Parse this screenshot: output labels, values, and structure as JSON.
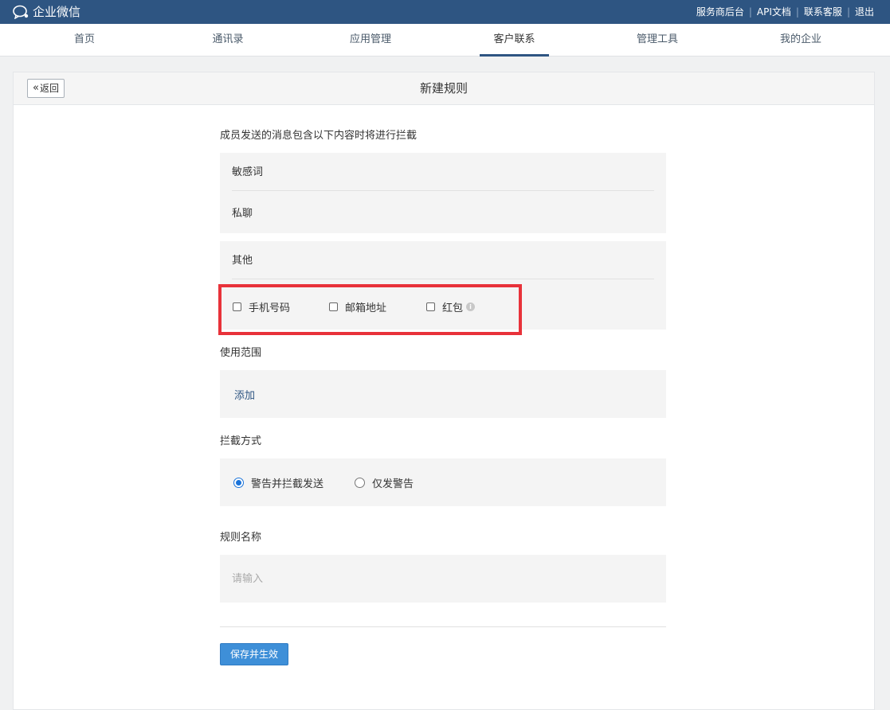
{
  "brand": {
    "name": "企业微信"
  },
  "top_links": [
    "服务商后台",
    "API文档",
    "联系客服",
    "退出"
  ],
  "nav": [
    "首页",
    "通讯录",
    "应用管理",
    "客户联系",
    "管理工具",
    "我的企业"
  ],
  "nav_active": "客户联系",
  "header": {
    "back_label": "返回",
    "title": "新建规则"
  },
  "intercept": {
    "label": "成员发送的消息包含以下内容时将进行拦截",
    "rows": [
      "敏感词",
      "私聊"
    ],
    "other_label": "其他",
    "options": [
      {
        "label": "手机号码",
        "checked": false
      },
      {
        "label": "邮箱地址",
        "checked": false
      },
      {
        "label": "红包",
        "checked": false
      }
    ]
  },
  "scope": {
    "label": "使用范围",
    "add_label": "添加"
  },
  "method": {
    "label": "拦截方式",
    "options": [
      {
        "label": "警告并拦截发送",
        "selected": true
      },
      {
        "label": "仅发警告",
        "selected": false
      }
    ]
  },
  "rule_name": {
    "label": "规则名称",
    "placeholder": "请输入",
    "value": ""
  },
  "save_label": "保存并生效",
  "colors": {
    "topbar": "#2e5582",
    "accent": "#3e8fd8",
    "highlight": "#e8323a",
    "radio": "#1a73d9"
  }
}
